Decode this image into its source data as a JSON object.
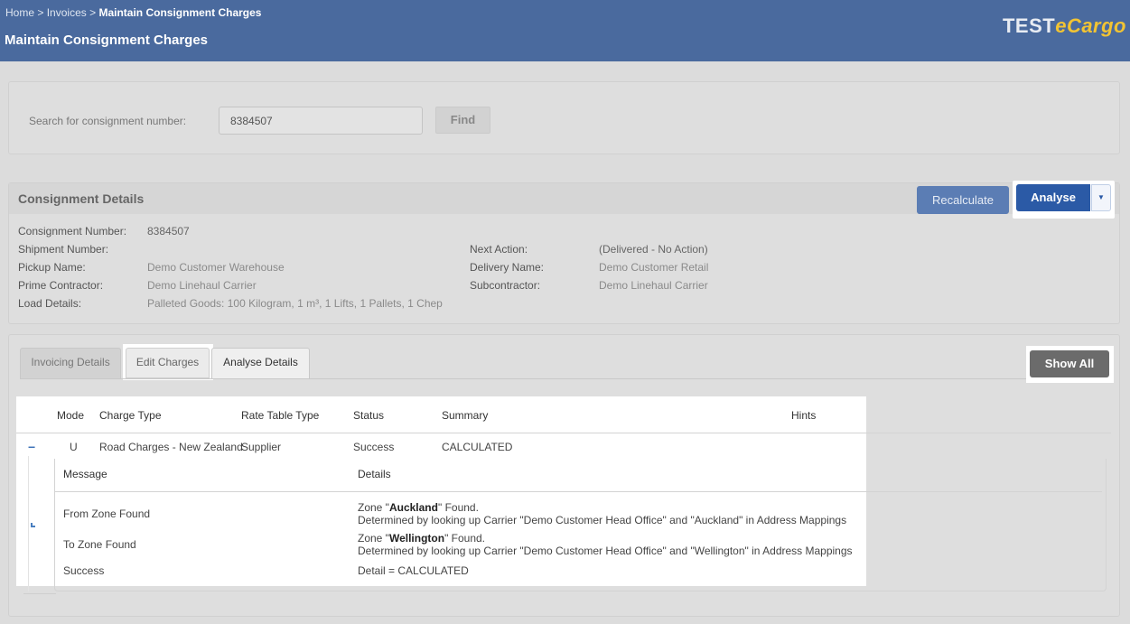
{
  "breadcrumb": {
    "home": "Home",
    "sep": ">",
    "invoices": "Invoices",
    "current": "Maintain Consignment Charges"
  },
  "page_title": "Maintain Consignment Charges",
  "logo": {
    "test": "TEST",
    "brand": "eCargo"
  },
  "search": {
    "label": "Search for consignment number:",
    "value": "8384507",
    "find_label": "Find"
  },
  "details": {
    "title": "Consignment Details",
    "recalculate_label": "Recalculate",
    "analyse_label": "Analyse",
    "left": [
      {
        "k": "Consignment Number:",
        "v": "8384507"
      },
      {
        "k": "Shipment Number:",
        "v": ""
      },
      {
        "k": "Pickup Name:",
        "v": "Demo Customer Warehouse"
      },
      {
        "k": "Prime Contractor:",
        "v": "Demo Linehaul Carrier"
      },
      {
        "k": "Load Details:",
        "v": "Palleted Goods: 100 Kilogram, 1 m³, 1 Lifts, 1 Pallets, 1 Chep"
      }
    ],
    "right": [
      {
        "k": "Next Action:",
        "v": "(Delivered - No Action)"
      },
      {
        "k": "Delivery Name:",
        "v": "Demo Customer Retail"
      },
      {
        "k": "Subcontractor:",
        "v": "Demo Linehaul Carrier"
      }
    ]
  },
  "tabs": {
    "invoicing": "Invoicing Details",
    "edit": "Edit Charges",
    "analyse": "Analyse Details"
  },
  "show_all_label": "Show All",
  "grid": {
    "headers": {
      "mode": "Mode",
      "charge_type": "Charge Type",
      "rate_table_type": "Rate Table Type",
      "status": "Status",
      "summary": "Summary",
      "hints": "Hints"
    },
    "row": {
      "toggle": "−",
      "mode": "U",
      "charge_type": "Road Charges - New Zealand",
      "rate_table_type": "Supplier",
      "status": "Success",
      "summary": "CALCULATED"
    },
    "sub_headers": {
      "message": "Message",
      "details": "Details"
    },
    "messages": [
      {
        "message": "From Zone Found",
        "line1_pre": "Zone \"",
        "line1_bold": "Auckland",
        "line1_post": "\" Found.",
        "line2": "Determined by looking up Carrier \"Demo Customer Head Office\" and \"Auckland\" in Address Mappings"
      },
      {
        "message": "To Zone Found",
        "line1_pre": "Zone \"",
        "line1_bold": "Wellington",
        "line1_post": "\" Found.",
        "line2": "Determined by looking up Carrier \"Demo Customer Head Office\" and \"Wellington\" in Address Mappings"
      },
      {
        "message": "Success",
        "detail": "Detail = CALCULATED"
      }
    ]
  }
}
